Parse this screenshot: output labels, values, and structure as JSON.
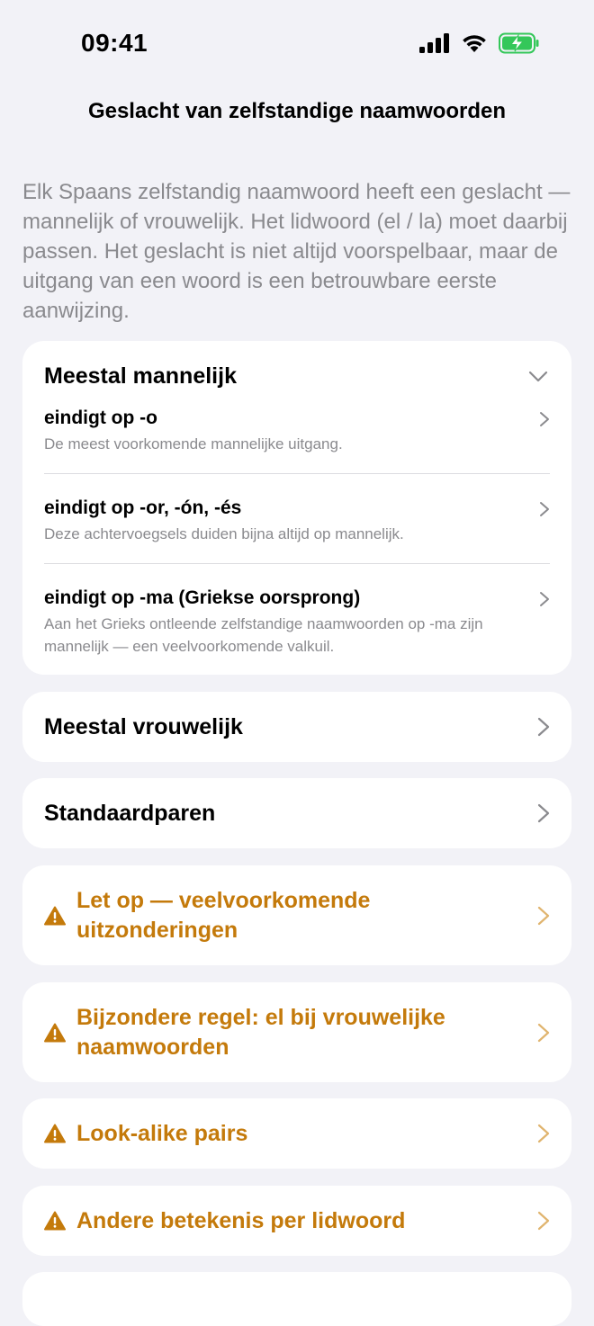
{
  "status": {
    "time": "09:41"
  },
  "nav": {
    "title": "Geslacht van zelfstandige naamwoorden"
  },
  "intro": "Elk Spaans zelfstandig naamwoord heeft een geslacht — mannelijk of vrouwelijk. Het lidwoord (el / la) moet daarbij passen. Het geslacht is niet altijd voorspelbaar, maar de uitgang van een woord is een betrouwbare eerste aanwijzing.",
  "sections": {
    "masculine": {
      "title": "Meestal mannelijk",
      "rows": [
        {
          "title": "eindigt op -o",
          "desc": "De meest voorkomende mannelijke uitgang."
        },
        {
          "title": "eindigt op -or, -ón, -és",
          "desc": "Deze achtervoegsels duiden bijna altijd op mannelijk."
        },
        {
          "title": "eindigt op -ma (Griekse oorsprong)",
          "desc": "Aan het Grieks ontleende zelfstandige naamwoorden op -ma zijn mannelijk — een veelvoorkomende valkuil."
        }
      ]
    },
    "feminine": {
      "title": "Meestal vrouwelijk"
    },
    "pairs": {
      "title": "Standaardparen"
    },
    "exceptions": {
      "title": "Let op — veelvoorkomende uitzonderingen"
    },
    "special_rule": {
      "title": "Bijzondere regel: el bij vrouwelijke naamwoorden"
    },
    "lookalike": {
      "title": "Look-alike pairs"
    },
    "meaning": {
      "title": "Andere betekenis per lidwoord"
    }
  },
  "colors": {
    "warning": "#c47a0b",
    "battery": "#34c759"
  }
}
